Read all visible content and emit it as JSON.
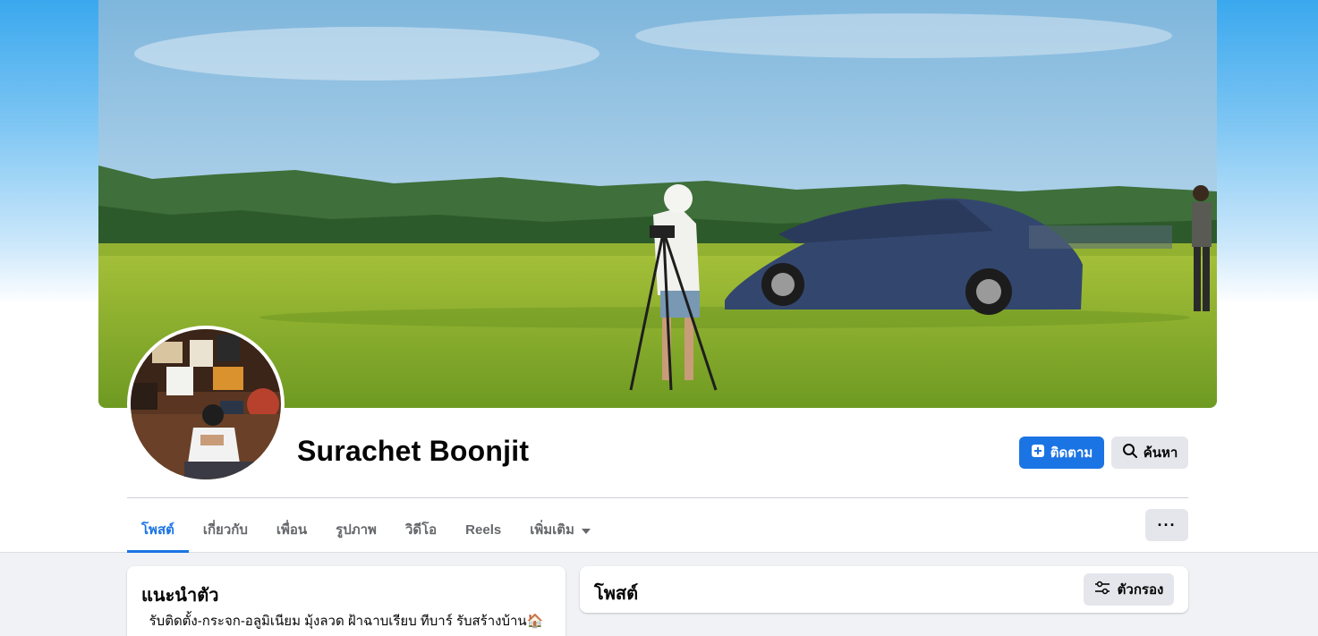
{
  "profile": {
    "name": "Surachet Boonjit"
  },
  "actions": {
    "follow_label": "ติดตาม",
    "search_label": "ค้นหา"
  },
  "tabs": [
    {
      "label": "โพสต์",
      "active": true
    },
    {
      "label": "เกี่ยวกับ"
    },
    {
      "label": "เพื่อน"
    },
    {
      "label": "รูปภาพ"
    },
    {
      "label": "วิดีโอ"
    },
    {
      "label": "Reels"
    },
    {
      "label": "เพิ่มเติม",
      "icon": "caret-down-icon"
    }
  ],
  "more_options_label": "···",
  "intro": {
    "title": "แนะนำตัว",
    "bio_line1": "รับติดตั้ง-กระจก-อลูมิเนียม มุ้งลวด ฝ้าฉาบเรียบ ทีบาร์ รับสร้างบ้าน🏠"
  },
  "posts": {
    "title": "โพสต์",
    "filter_label": "ตัวกรอง"
  },
  "colors": {
    "accent": "#1b74e4",
    "background": "#f0f2f5",
    "secondary_button": "#e4e6eb"
  }
}
